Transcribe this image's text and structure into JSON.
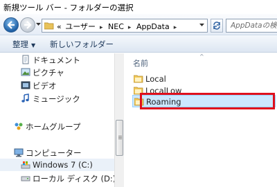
{
  "window": {
    "title": "新規ツール バー - フォルダーの選択"
  },
  "address": {
    "chevron": "«",
    "crumbs": [
      "ユーザー",
      "NEC",
      "AppData"
    ],
    "separator": "▸"
  },
  "search": {
    "placeholder": "AppDataの検索"
  },
  "toolbar": {
    "organize_label": "整理",
    "organize_caret": "▼",
    "new_folder_label": "新しいフォルダー"
  },
  "nav": {
    "items": [
      {
        "label": "ドキュメント",
        "icon": "document-icon"
      },
      {
        "label": "ピクチャ",
        "icon": "picture-icon"
      },
      {
        "label": "ビデオ",
        "icon": "video-icon"
      },
      {
        "label": "ミュージック",
        "icon": "music-icon"
      },
      {
        "label": "ホームグループ",
        "icon": "homegroup-icon"
      },
      {
        "label": "コンピューター",
        "icon": "computer-icon"
      },
      {
        "label": "Windows 7 (C:)",
        "icon": "drive-icon",
        "selected": true
      },
      {
        "label": "ローカル ディスク (D:)",
        "icon": "disk-icon"
      }
    ]
  },
  "content": {
    "column_header": "名前",
    "items": [
      {
        "name": "Local"
      },
      {
        "name": "LocalLow"
      },
      {
        "name": "Roaming",
        "selected": true,
        "highlighted": true
      }
    ]
  },
  "colors": {
    "highlight_border": "#e0101c",
    "selection": "#cce8ff"
  }
}
